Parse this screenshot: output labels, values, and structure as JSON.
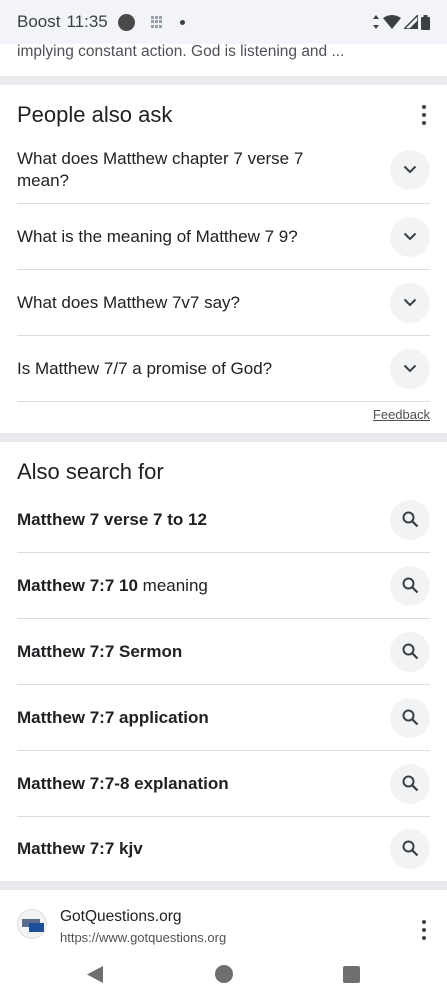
{
  "status_bar": {
    "carrier": "Boost",
    "time": "11:35"
  },
  "snippet_tail": "implying constant action. God is listening and ...",
  "people_also_ask": {
    "title": "People also ask",
    "questions": [
      "What does Matthew chapter 7 verse 7 mean?",
      "What is the meaning of Matthew 7 9?",
      "What does Matthew 7v7 say?",
      "Is Matthew 7/7 a promise of God?"
    ],
    "feedback_label": "Feedback"
  },
  "also_search_for": {
    "title": "Also search for",
    "items": [
      {
        "bold": "Matthew 7 verse 7 to 12",
        "normal": ""
      },
      {
        "bold": "Matthew 7:7 10",
        "normal": " meaning"
      },
      {
        "bold": "Matthew 7:7 Sermon",
        "normal": ""
      },
      {
        "bold": "Matthew 7:7 application",
        "normal": ""
      },
      {
        "bold": "Matthew 7:7-8 explanation",
        "normal": ""
      },
      {
        "bold": "Matthew 7:7 kjv",
        "normal": ""
      }
    ]
  },
  "result": {
    "site_name": "GotQuestions.org",
    "url": "https://www.gotquestions.org"
  },
  "icons": {
    "expand": "chevron-down-icon",
    "search": "search-icon",
    "more": "more-vert-icon"
  }
}
